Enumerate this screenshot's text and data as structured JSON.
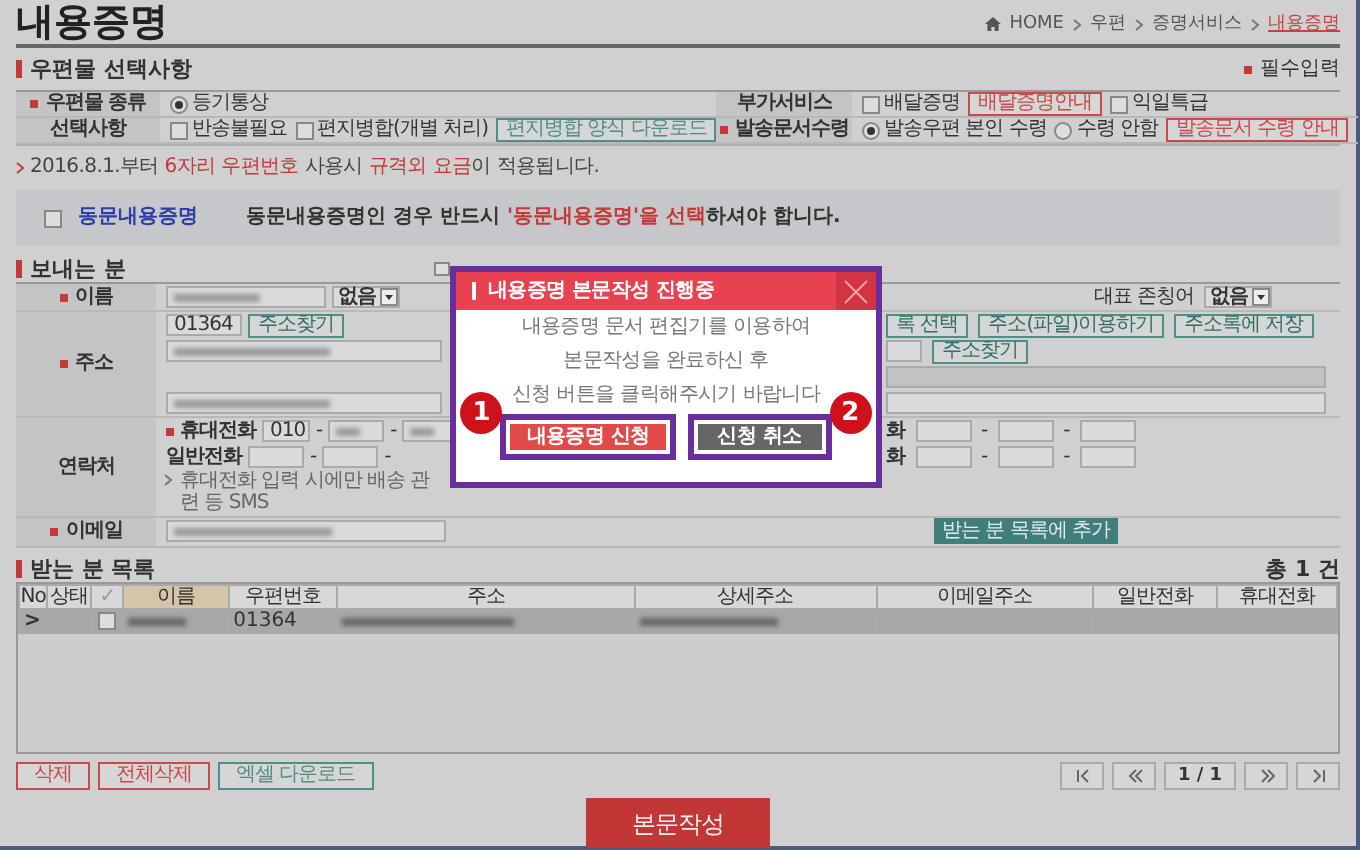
{
  "page_title": "내용증명",
  "breadcrumb": [
    {
      "label": "HOME",
      "current": false
    },
    {
      "label": "우편",
      "current": false
    },
    {
      "label": "증명서비스",
      "current": false
    },
    {
      "label": "내용증명",
      "current": true
    }
  ],
  "mail_options": {
    "title": "우편물 선택사항",
    "required_note": "필수입력",
    "rows": [
      {
        "left": {
          "label": "우편물 종류",
          "required": true,
          "controls": [
            {
              "kind": "radio",
              "label": "등기통상",
              "selected": true
            }
          ]
        },
        "right": {
          "label": "부가서비스",
          "required": false,
          "controls": [
            {
              "kind": "checkbox",
              "label": "배달증명",
              "checked": false
            },
            {
              "kind": "button",
              "label": "배달증명안내",
              "color": "#c94a4a"
            },
            {
              "kind": "checkbox",
              "label": "익일특급",
              "checked": false
            }
          ]
        }
      },
      {
        "left": {
          "label": "선택사항",
          "required": false,
          "controls": [
            {
              "kind": "checkbox",
              "label": "반송불필요",
              "checked": false
            },
            {
              "kind": "checkbox",
              "label": "편지병합(개별 처리)",
              "checked": false
            },
            {
              "kind": "button",
              "label": "편지병합 양식 다운로드",
              "color": "#4f8f8a"
            }
          ]
        },
        "right": {
          "label": "발송문서수령",
          "required": true,
          "controls": [
            {
              "kind": "radio",
              "label": "발송우편 본인 수령",
              "selected": true
            },
            {
              "kind": "radio",
              "label": "수령 안함",
              "selected": false
            },
            {
              "kind": "button",
              "label": "발송문서 수령 안내",
              "color": "#c94a4a"
            }
          ]
        }
      }
    ],
    "notice": [
      {
        "text": "2016.8.1.부터 ",
        "highlight": false
      },
      {
        "text": "6자리 우편번호",
        "highlight": true
      },
      {
        "text": " 사용시 ",
        "highlight": false
      },
      {
        "text": "규격외 요금",
        "highlight": true
      },
      {
        "text": "이 적용됩니다.",
        "highlight": false
      }
    ],
    "bulk": {
      "checked": false,
      "label": "동문내용증명",
      "message": [
        {
          "text": "동문내용증명인 경우 반드시 ",
          "highlight": false
        },
        {
          "text": "'동문내용증명'을 선택",
          "highlight": true
        },
        {
          "text": "하셔야 합니다.",
          "highlight": false
        }
      ]
    }
  },
  "sender": {
    "title": "보내는 분",
    "name": {
      "label": "이름",
      "required": true,
      "select": "없음"
    },
    "honorific": {
      "label": "대표 존칭어",
      "select": "없음"
    },
    "address": {
      "label": "주소",
      "required": true,
      "postcode": "01364",
      "find_button": "주소찾기"
    },
    "address_tools": [
      "록 선택",
      "주소(파일)이용하기",
      "주소록에 저장"
    ],
    "second_find_button": "주소찾기",
    "contact": {
      "label": "연락처",
      "lines": [
        {
          "label": "휴대전화",
          "required": true,
          "parts": [
            {
              "kind": "field",
              "value": "010"
            },
            {
              "kind": "dash",
              "text": "-"
            },
            {
              "kind": "field",
              "blurred": true
            },
            {
              "kind": "dash",
              "text": "-"
            },
            {
              "kind": "field",
              "blurred": true
            }
          ],
          "right_label": "화",
          "right_parts": [
            {
              "kind": "field"
            },
            {
              "kind": "dash",
              "text": "-"
            },
            {
              "kind": "field"
            },
            {
              "kind": "dash",
              "text": "-"
            },
            {
              "kind": "field"
            }
          ]
        },
        {
          "label": "일반전화",
          "required": false,
          "parts": [
            {
              "kind": "field"
            },
            {
              "kind": "dash",
              "text": "-"
            },
            {
              "kind": "field"
            },
            {
              "kind": "dash",
              "text": "-"
            }
          ],
          "right_label": "화",
          "right_parts": [
            {
              "kind": "field"
            },
            {
              "kind": "dash",
              "text": "-"
            },
            {
              "kind": "field"
            },
            {
              "kind": "dash",
              "text": "-"
            },
            {
              "kind": "field"
            }
          ]
        }
      ],
      "note": "휴대전화 입력 시에만 배송 관련 등 SMS"
    },
    "email": {
      "label": "이메일",
      "required": true
    },
    "add_button": "받는 분 목록에 추가"
  },
  "recipients": {
    "title": "받는 분 목록",
    "total": "총 1 건",
    "columns": [
      {
        "label": "No",
        "sorted": false
      },
      {
        "label": "상태",
        "sorted": false
      },
      {
        "label": "✓",
        "sorted": false
      },
      {
        "label": "이름",
        "sorted": true
      },
      {
        "label": "우편번호",
        "sorted": false
      },
      {
        "label": "주소",
        "sorted": false
      },
      {
        "label": "상세주소",
        "sorted": false
      },
      {
        "label": "이메일주소",
        "sorted": false
      },
      {
        "label": "일반전화",
        "sorted": false
      },
      {
        "label": "휴대전화",
        "sorted": false
      }
    ],
    "rows": [
      {
        "selected": true,
        "cells": [
          {
            "kind": "text",
            "text": ">"
          },
          {
            "kind": "empty"
          },
          {
            "kind": "checkbox",
            "checked": false
          },
          {
            "kind": "blurred"
          },
          {
            "kind": "text",
            "text": "01364"
          },
          {
            "kind": "blurred"
          },
          {
            "kind": "blurred"
          },
          {
            "kind": "empty"
          },
          {
            "kind": "empty"
          },
          {
            "kind": "empty"
          }
        ]
      }
    ]
  },
  "list_actions": [
    {
      "label": "삭제",
      "color": "#c94a4a"
    },
    {
      "label": "전체삭제",
      "color": "#c94a4a"
    },
    {
      "label": "엑셀 다운로드",
      "color": "#4f8f8a"
    }
  ],
  "pager": {
    "page": "1 / 1"
  },
  "submit_button": "본문작성",
  "modal": {
    "title": "내용증명 본문작성 진행중",
    "lines": [
      "내용증명 문서 편집기를 이용하여",
      "본문작성을 완료하신 후",
      "신청 버튼을 클릭해주시기 바랍니다"
    ],
    "buttons": [
      {
        "label": "내용증명 신청",
        "color": "#e24a4a",
        "step": "1"
      },
      {
        "label": "신청 취소",
        "color": "#666666",
        "step": "2"
      }
    ]
  }
}
